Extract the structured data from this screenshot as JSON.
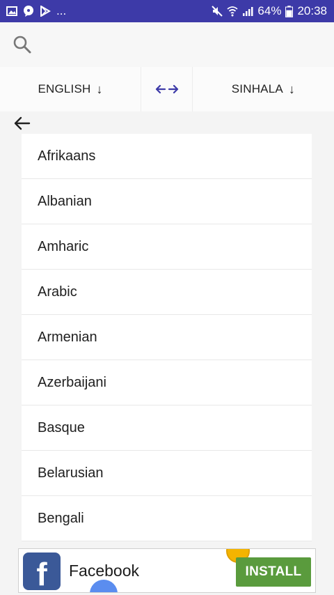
{
  "status_bar": {
    "left_icons": [
      "image-icon",
      "chat-icon",
      "play-store-icon"
    ],
    "overflow_dots": "...",
    "battery_percent": "64%",
    "time": "20:38"
  },
  "search": {
    "icon": "search-icon"
  },
  "language_selector": {
    "source": "ENGLISH",
    "swap_symbol": "←→",
    "target": "SINHALA",
    "down_arrow": "↓"
  },
  "languages": [
    "Afrikaans",
    "Albanian",
    "Amharic",
    "Arabic",
    "Armenian",
    "Azerbaijani",
    "Basque",
    "Belarusian",
    "Bengali"
  ],
  "ad": {
    "logo_letter": "f",
    "title": "Facebook",
    "button": "INSTALL"
  },
  "colors": {
    "status_bar": "#3d3aa8",
    "swap_arrows": "#3d3aa8",
    "install_button": "#5a9b3d",
    "facebook_blue": "#3b5998"
  }
}
